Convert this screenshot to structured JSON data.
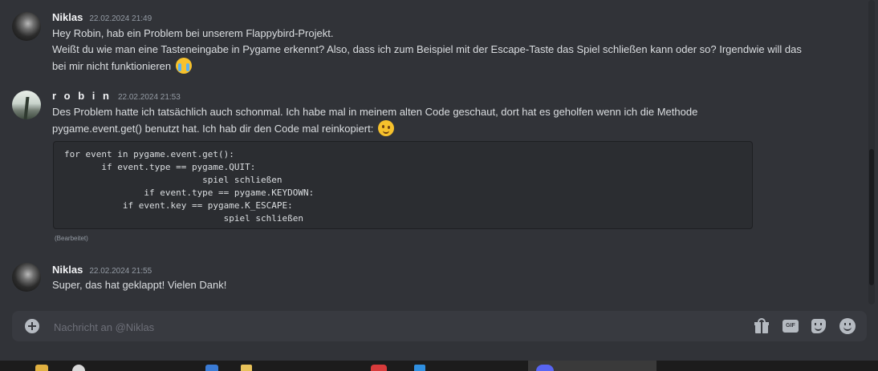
{
  "messages": [
    {
      "author": "Niklas",
      "time": "22.02.2024 21:49",
      "lines": [
        "Hey Robin, hab ein Problem bei unserem Flappybird-Projekt.",
        "Weißt du wie man eine Tasteneingabe in Pygame erkennt? Also, dass ich zum Beispiel mit der Escape-Taste das Spiel schließen kann oder so? Irgendwie will das",
        "bei mir nicht funktionieren"
      ],
      "emoji": "crying-face"
    },
    {
      "author": "r o b i n",
      "time": "22.02.2024 21:53",
      "lines": [
        "Des Problem hatte ich tatsächlich auch schonmal. Ich habe mal in meinem alten Code geschaut, dort hat es geholfen wenn ich die Methode",
        "pygame.event.get() benutzt hat. Ich hab dir den Code mal reinkopiert:"
      ],
      "emoji": "winking-face",
      "code": "for event in pygame.event.get():\n       if event.type == pygame.QUIT:\n                          spiel schließen\n               if event.type == pygame.KEYDOWN:\n           if event.key == pygame.K_ESCAPE:\n                              spiel schließen",
      "edited": "(Bearbeitet)"
    },
    {
      "author": "Niklas",
      "time": "22.02.2024 21:55",
      "lines": [
        "Super, das hat geklappt! Vielen Dank!"
      ]
    }
  ],
  "composer": {
    "placeholder": "Nachricht an @Niklas",
    "gif_label": "GIF"
  },
  "icons": {
    "add": "add-circle-icon",
    "gift": "gift-icon",
    "gif": "gif-icon",
    "sticker": "sticker-icon",
    "emoji": "emoji-icon"
  }
}
